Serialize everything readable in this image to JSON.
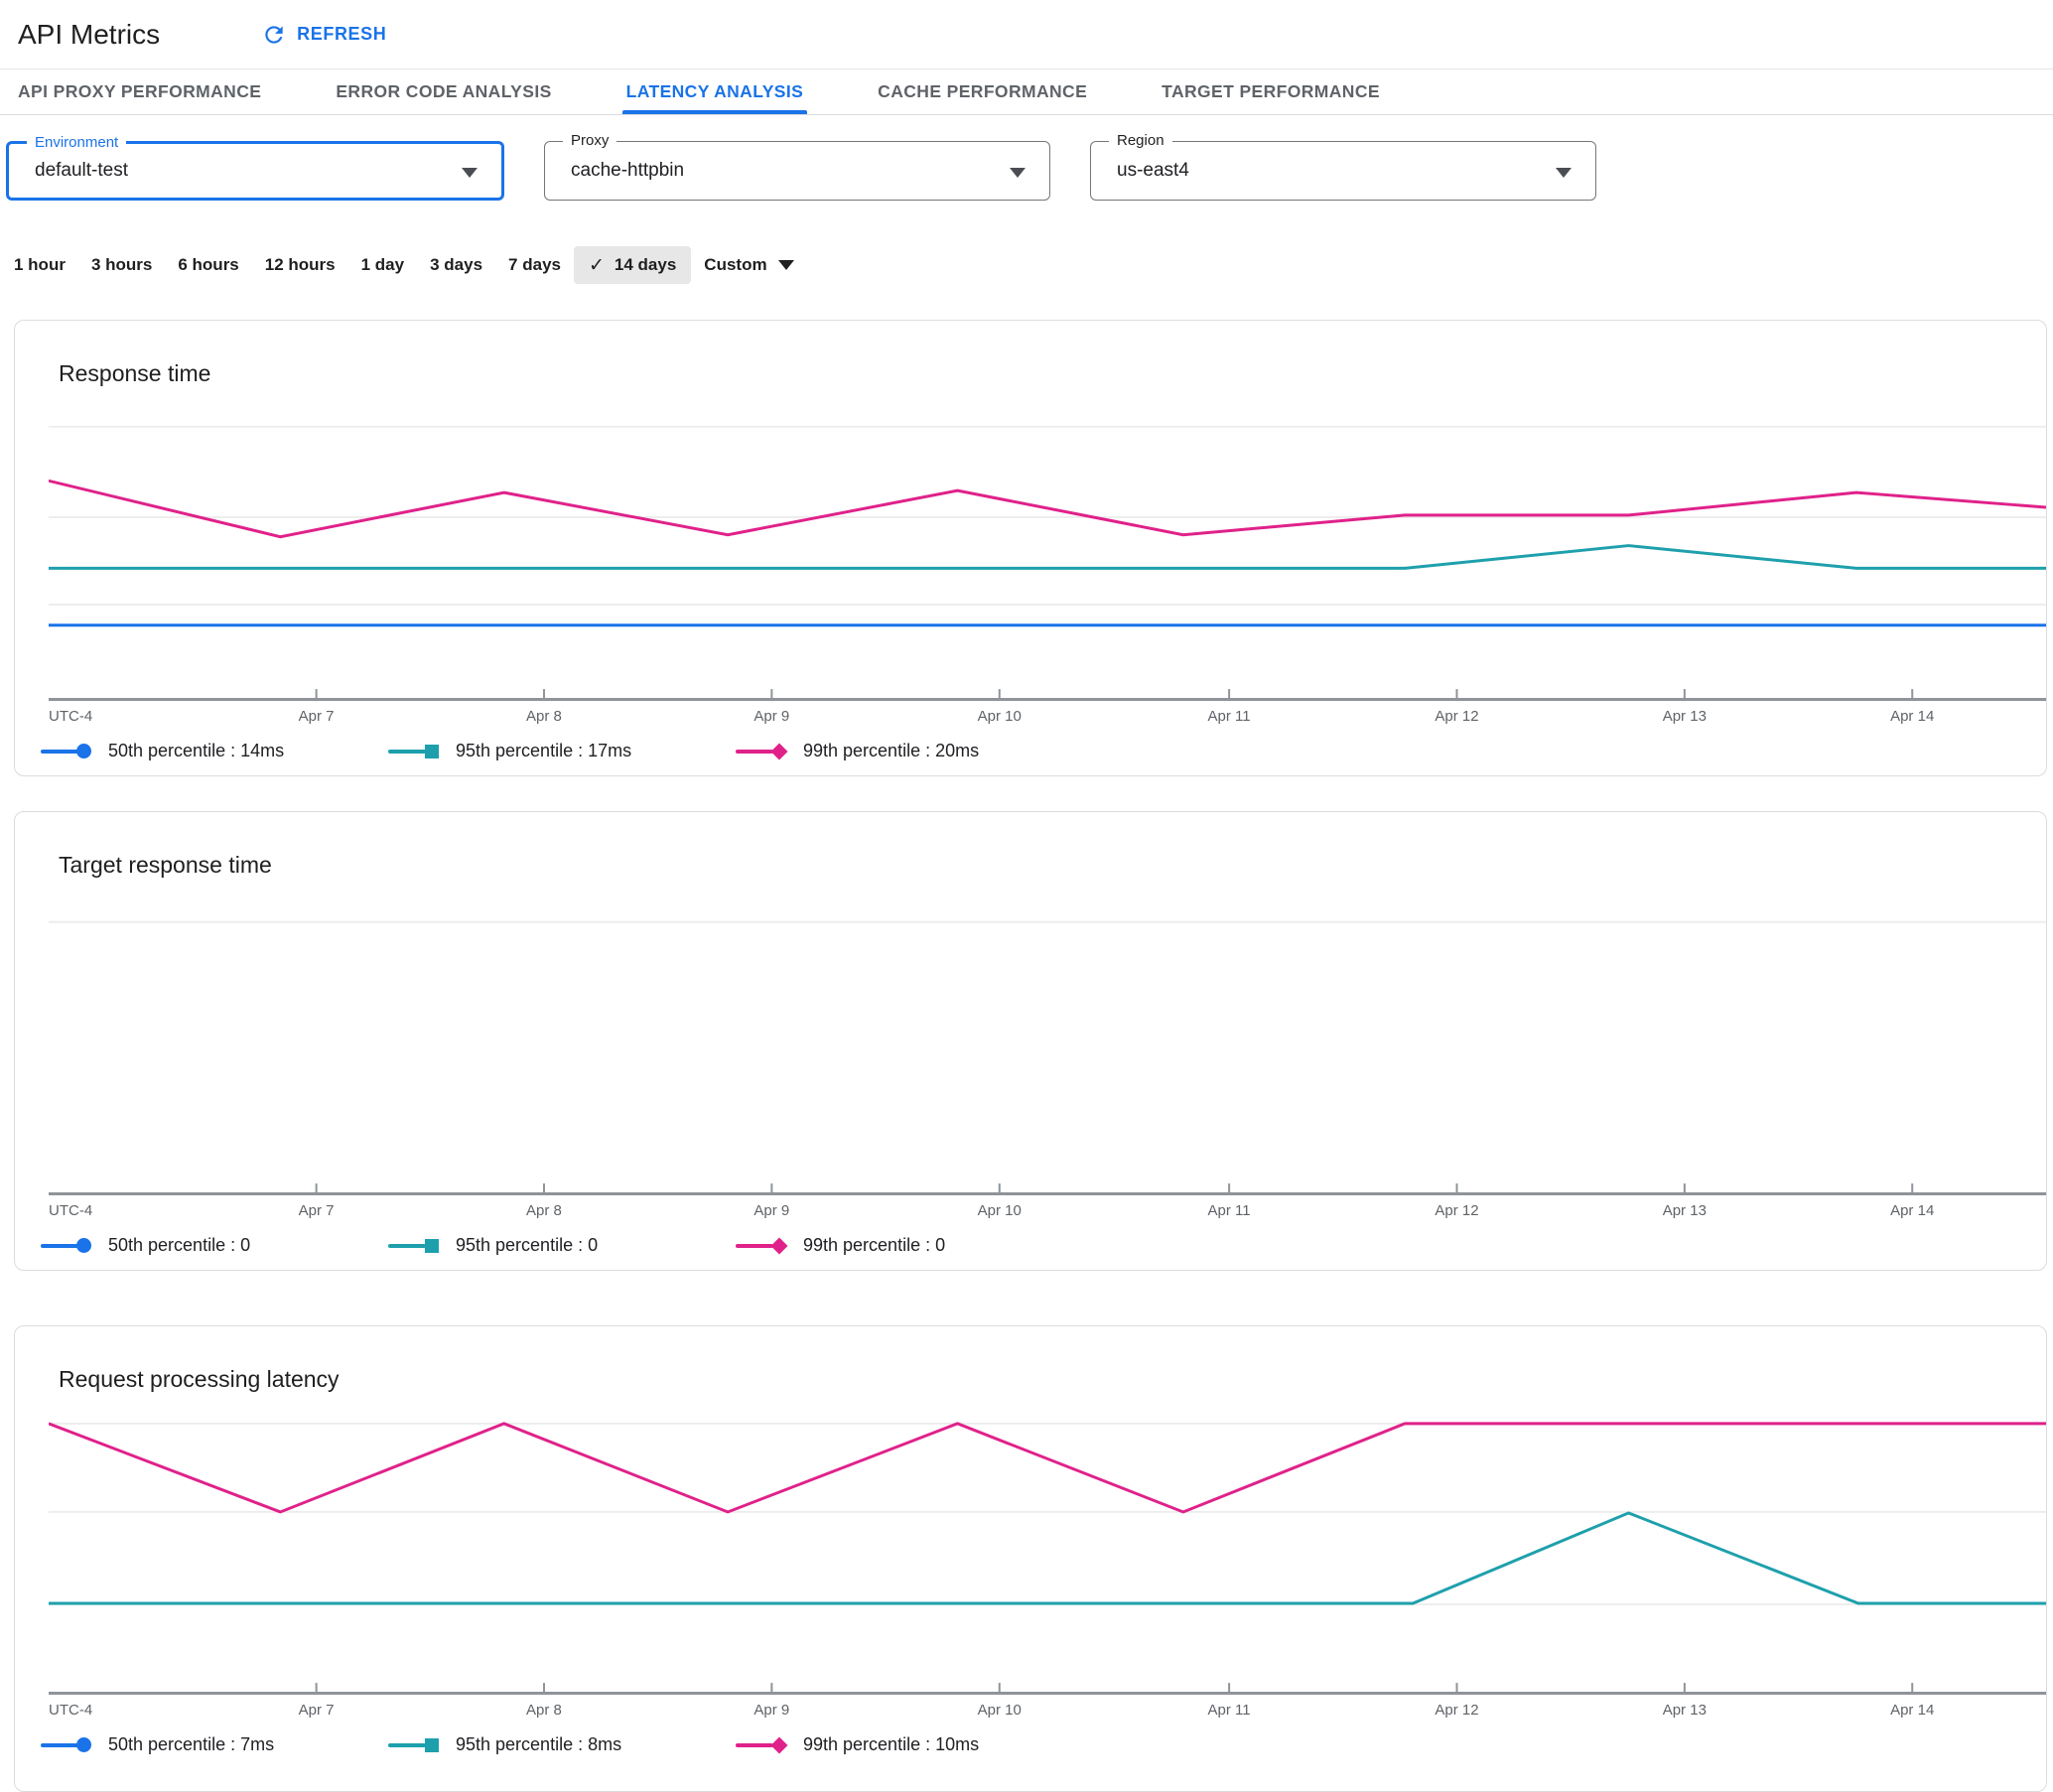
{
  "colors": {
    "blue": "#1A73E8",
    "teal": "#1EA0AC",
    "pink": "#E0218A",
    "axis": "#8E9499",
    "grid": "#EDEDED"
  },
  "icons": {
    "refresh": "circular-arrow-refresh",
    "dropdown_arrow": "filled-triangle-down",
    "check": "checkmark",
    "legend_markers": [
      "line-circle",
      "line-square",
      "line-diamond"
    ]
  },
  "glyphs": {
    "check": "✓"
  },
  "header": {
    "title": "API Metrics",
    "refresh_label": "REFRESH"
  },
  "tabs": [
    {
      "label": "API PROXY PERFORMANCE",
      "active": false
    },
    {
      "label": "ERROR CODE ANALYSIS",
      "active": false
    },
    {
      "label": "LATENCY ANALYSIS",
      "active": true
    },
    {
      "label": "CACHE PERFORMANCE",
      "active": false
    },
    {
      "label": "TARGET PERFORMANCE",
      "active": false
    }
  ],
  "filters": [
    {
      "label": "Environment",
      "value": "default-test",
      "focused": true
    },
    {
      "label": "Proxy",
      "value": "cache-httpbin",
      "focused": false
    },
    {
      "label": "Region",
      "value": "us-east4",
      "focused": false
    }
  ],
  "time_ranges": [
    {
      "label": "1 hour",
      "selected": false
    },
    {
      "label": "3 hours",
      "selected": false
    },
    {
      "label": "6 hours",
      "selected": false
    },
    {
      "label": "12 hours",
      "selected": false
    },
    {
      "label": "1 day",
      "selected": false
    },
    {
      "label": "3 days",
      "selected": false
    },
    {
      "label": "7 days",
      "selected": false
    },
    {
      "label": "14 days",
      "selected": true
    },
    {
      "label": "Custom",
      "selected": false,
      "dropdown": true
    }
  ],
  "axis": {
    "origin_label": "UTC-4",
    "ticks": [
      {
        "label": "Apr 7",
        "x": 0.134
      },
      {
        "label": "Apr 8",
        "x": 0.248
      },
      {
        "label": "Apr 9",
        "x": 0.362
      },
      {
        "label": "Apr 10",
        "x": 0.476
      },
      {
        "label": "Apr 11",
        "x": 0.591
      },
      {
        "label": "Apr 12",
        "x": 0.705
      },
      {
        "label": "Apr 13",
        "x": 0.819
      },
      {
        "label": "Apr 14",
        "x": 0.933
      }
    ]
  },
  "charts": [
    {
      "title": "Response time",
      "gridlines": [
        18,
        110,
        199
      ],
      "series": [
        {
          "name": "99th percentile",
          "color": "pink",
          "points": [
            [
              0,
              73
            ],
            [
              0.116,
              130
            ],
            [
              0.228,
              85
            ],
            [
              0.34,
              128
            ],
            [
              0.455,
              83
            ],
            [
              0.568,
              128
            ],
            [
              0.679,
              108
            ],
            [
              0.791,
              108
            ],
            [
              0.905,
              85
            ],
            [
              1,
              100
            ]
          ]
        },
        {
          "name": "95th percentile",
          "color": "teal",
          "points": [
            [
              0,
              162
            ],
            [
              0.679,
              162
            ],
            [
              0.791,
              139
            ],
            [
              0.905,
              162
            ],
            [
              1,
              162
            ]
          ]
        },
        {
          "name": "50th percentile",
          "color": "blue",
          "points": [
            [
              0,
              220
            ],
            [
              1,
              220
            ]
          ]
        }
      ],
      "legend": [
        {
          "text": "50th percentile : 14ms",
          "color": "blue",
          "marker": "circle"
        },
        {
          "text": "95th percentile : 17ms",
          "color": "teal",
          "marker": "square"
        },
        {
          "text": "99th percentile : 20ms",
          "color": "pink",
          "marker": "diamond"
        }
      ]
    },
    {
      "title": "Target response time",
      "gridlines": [
        22
      ],
      "series": [],
      "legend": [
        {
          "text": "50th percentile : 0",
          "color": "blue",
          "marker": "circle"
        },
        {
          "text": "95th percentile : 0",
          "color": "teal",
          "marker": "square"
        },
        {
          "text": "99th percentile : 0",
          "color": "pink",
          "marker": "diamond"
        }
      ]
    },
    {
      "title": "Request processing latency",
      "gridlines": [
        9,
        99,
        193
      ],
      "series": [
        {
          "name": "99th percentile",
          "color": "pink",
          "points": [
            [
              0,
              9
            ],
            [
              0.116,
              99
            ],
            [
              0.228,
              9
            ],
            [
              0.34,
              99
            ],
            [
              0.455,
              9
            ],
            [
              0.568,
              99
            ],
            [
              0.679,
              9
            ],
            [
              1,
              9
            ]
          ]
        },
        {
          "name": "95th percentile",
          "color": "teal",
          "points": [
            [
              0,
              192
            ],
            [
              0.683,
              192
            ],
            [
              0.791,
              100
            ],
            [
              0.906,
              192
            ],
            [
              1,
              192
            ]
          ]
        }
      ],
      "legend": [
        {
          "text": "50th percentile : 7ms",
          "color": "blue",
          "marker": "circle"
        },
        {
          "text": "95th percentile : 8ms",
          "color": "teal",
          "marker": "square"
        },
        {
          "text": "99th percentile : 10ms",
          "color": "pink",
          "marker": "diamond"
        }
      ]
    }
  ],
  "chart_data": [
    {
      "type": "line",
      "title": "Response time",
      "x_labels": [
        "Apr 7",
        "Apr 8",
        "Apr 9",
        "Apr 10",
        "Apr 11",
        "Apr 12",
        "Apr 13",
        "Apr 14"
      ],
      "series": [
        {
          "name": "50th percentile",
          "current": "14ms"
        },
        {
          "name": "95th percentile",
          "current": "17ms"
        },
        {
          "name": "99th percentile",
          "current": "20ms"
        }
      ],
      "timezone": "UTC-4",
      "legend_position": "bottom"
    },
    {
      "type": "line",
      "title": "Target response time",
      "x_labels": [
        "Apr 7",
        "Apr 8",
        "Apr 9",
        "Apr 10",
        "Apr 11",
        "Apr 12",
        "Apr 13",
        "Apr 14"
      ],
      "series": [
        {
          "name": "50th percentile",
          "current": "0"
        },
        {
          "name": "95th percentile",
          "current": "0"
        },
        {
          "name": "99th percentile",
          "current": "0"
        }
      ],
      "timezone": "UTC-4",
      "legend_position": "bottom"
    },
    {
      "type": "line",
      "title": "Request processing latency",
      "x_labels": [
        "Apr 7",
        "Apr 8",
        "Apr 9",
        "Apr 10",
        "Apr 11",
        "Apr 12",
        "Apr 13",
        "Apr 14"
      ],
      "series": [
        {
          "name": "50th percentile",
          "current": "7ms"
        },
        {
          "name": "95th percentile",
          "current": "8ms"
        },
        {
          "name": "99th percentile",
          "current": "10ms"
        }
      ],
      "timezone": "UTC-4",
      "legend_position": "bottom"
    }
  ]
}
